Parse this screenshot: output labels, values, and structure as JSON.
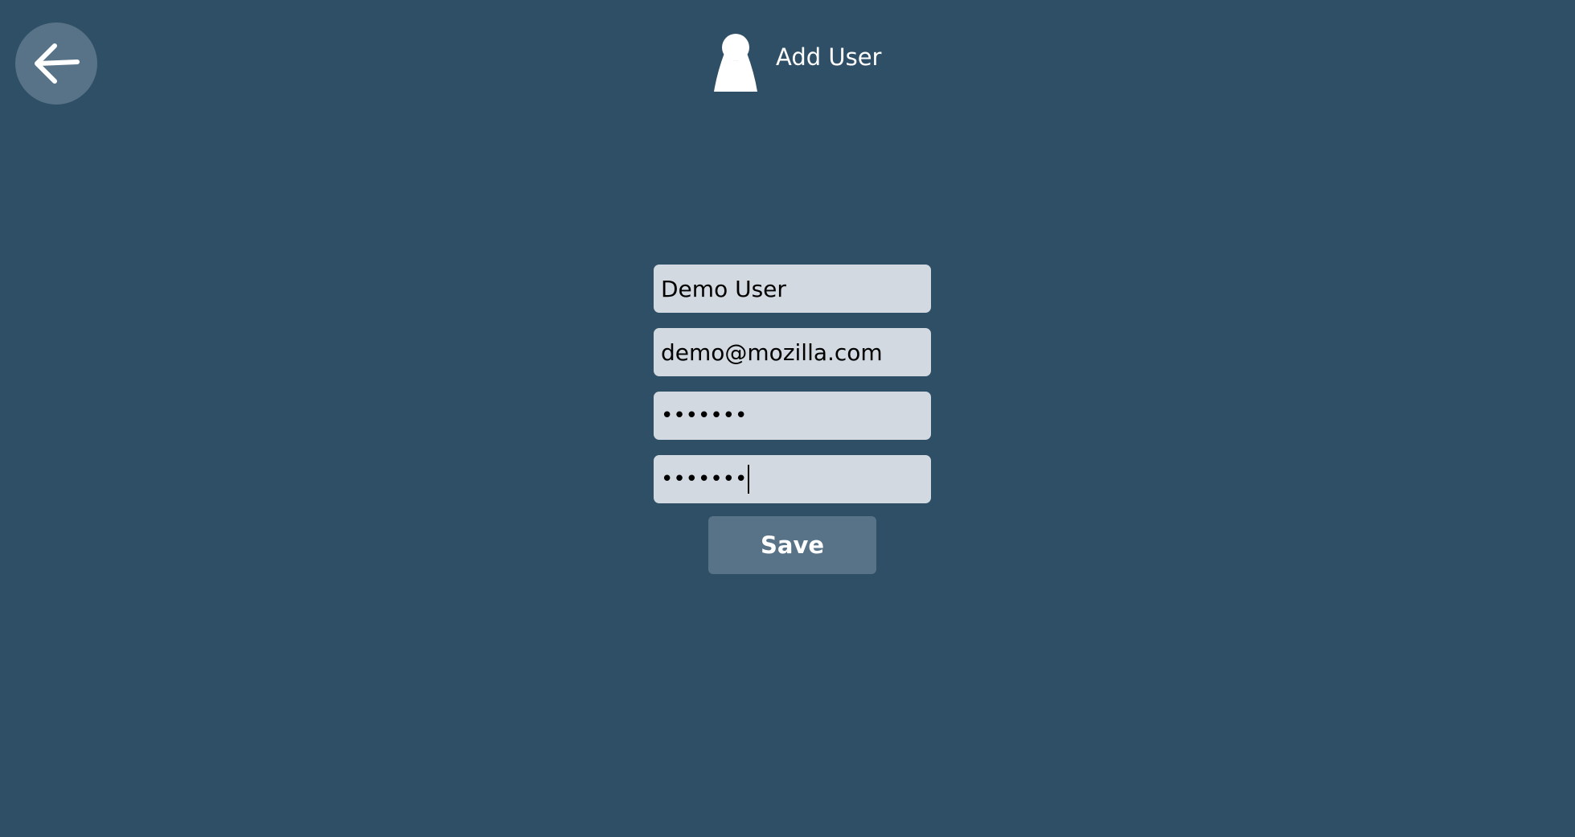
{
  "header": {
    "title": "Add User",
    "icon": "user-icon"
  },
  "back_button": {
    "icon": "arrow-left-icon"
  },
  "form": {
    "name_value": "Demo User",
    "email_value": "demo@mozilla.com",
    "password_value": "•••••••",
    "confirm_password_value": "•••••••"
  },
  "save_button": {
    "label": "Save"
  },
  "colors": {
    "background": "#2f4f67",
    "button": "#587388",
    "field": "#d2d9e0",
    "text_light": "#ffffff"
  }
}
